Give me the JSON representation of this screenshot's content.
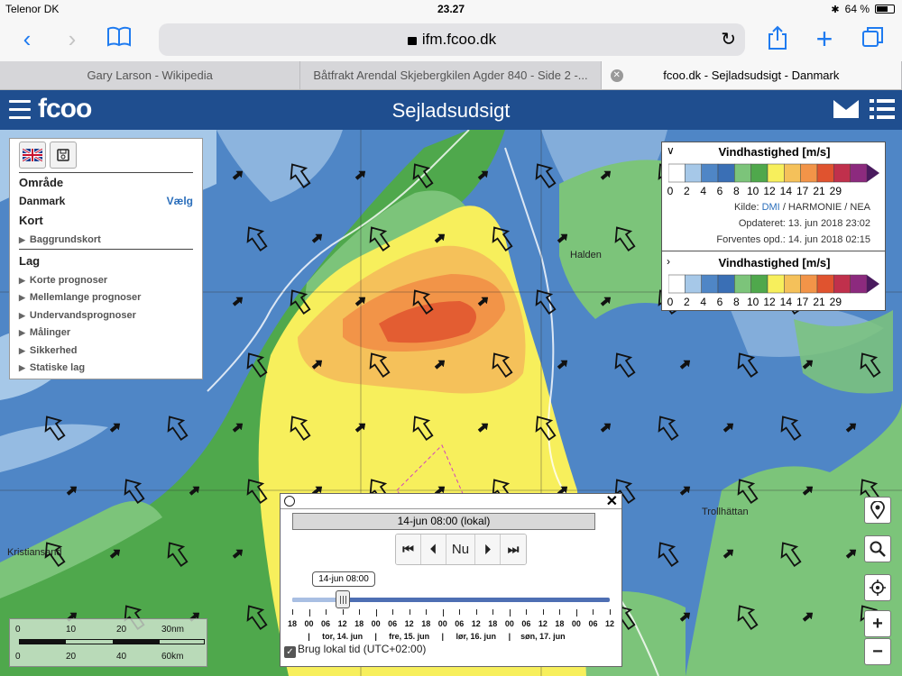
{
  "statusbar": {
    "carrier": "Telenor DK",
    "time": "23.27",
    "battery": "64 %",
    "battery_level": 0.64
  },
  "browser": {
    "url": "ifm.fcoo.dk",
    "tabs": [
      {
        "label": "Gary Larson - Wikipedia"
      },
      {
        "label": "Båtfrakt Arendal Skjebergkilen Agder 840 - Side 2 -..."
      },
      {
        "label": "fcoo.dk - Sejladsudsigt - Danmark"
      }
    ]
  },
  "app": {
    "logo": "fcoo",
    "title": "Sejladsudsigt"
  },
  "leftpanel": {
    "area_heading": "Område",
    "area_value": "Danmark",
    "area_link": "Vælg",
    "map_heading": "Kort",
    "map_items": [
      "Baggrundskort"
    ],
    "layer_heading": "Lag",
    "layer_items": [
      "Korte prognoser",
      "Mellemlange prognoser",
      "Undervandsprognoser",
      "Målinger",
      "Sikkerhed",
      "Statiske lag"
    ]
  },
  "legend": {
    "title": "Vindhastighed [m/s]",
    "ticks": [
      "0",
      "2",
      "4",
      "6",
      "8",
      "10",
      "12",
      "14",
      "17",
      "21",
      "29"
    ],
    "colors": [
      "#ffffff",
      "#a6c8e8",
      "#4f86c6",
      "#3a6fb5",
      "#7cc47a",
      "#4fa84c",
      "#f7ef5c",
      "#f5c15a",
      "#f29448",
      "#e0532f",
      "#c0304c",
      "#8c2a7e"
    ],
    "source_label": "Kilde:",
    "source_dmi": "DMI",
    "source_rest": "/ HARMONIE / NEA",
    "updated": "Opdateret: 13. jun 2018 23:02",
    "expected": "Forventes opd.: 14. jun 2018 02:15",
    "second_title": "Vindhastighed [m/s]"
  },
  "map": {
    "places": [
      "Kristiansand",
      "Trollhättan",
      "Halden"
    ]
  },
  "timecontrol": {
    "current": "14-jun 08:00 (lokal)",
    "nu_label": "Nu",
    "bubble": "14-jun 08:00",
    "position_fraction": 0.16,
    "hour_labels": [
      "18",
      "00",
      "06",
      "12",
      "18",
      "00",
      "06",
      "12",
      "18",
      "00",
      "06",
      "12",
      "18",
      "00",
      "06",
      "12",
      "18",
      "00",
      "06",
      "12"
    ],
    "days": [
      "tor, 14. jun",
      "fre, 15. jun",
      "lør, 16. jun",
      "søn, 17. jun"
    ],
    "local_time_label": "Brug lokal tid (UTC+02:00)",
    "local_time_checked": true
  },
  "scalebar": {
    "nm_labels": [
      "0",
      "10",
      "20",
      "30nm"
    ],
    "km_labels": [
      "0",
      "20",
      "40",
      "60km"
    ]
  }
}
